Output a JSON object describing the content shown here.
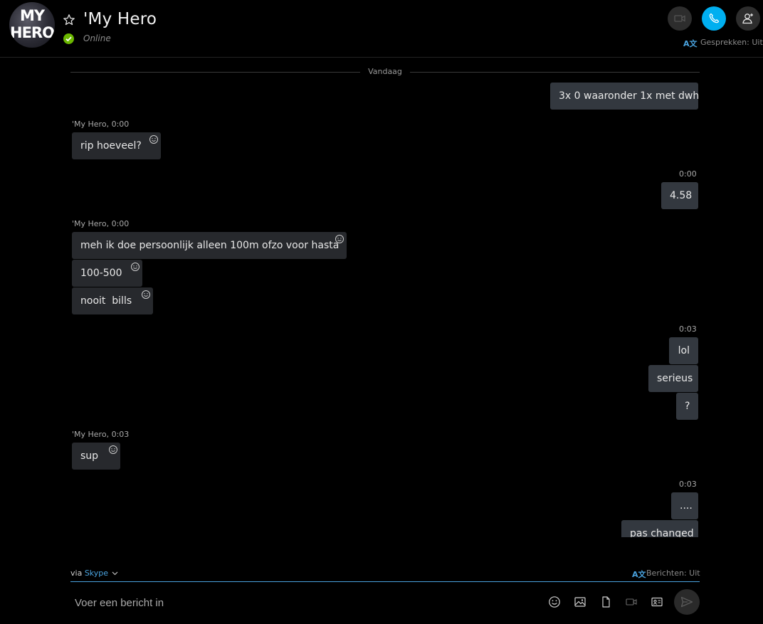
{
  "header": {
    "avatar_text_line1": "MY",
    "avatar_text_line2": "HERO",
    "contact_name": "'My Hero",
    "status": "Online",
    "translator_icon": "A文",
    "translator_label": "Gesprekken: Uit"
  },
  "messages": {
    "date_divider": "Vandaag",
    "items": [
      {
        "type": "out",
        "text": "3x 0 waaronder 1x met dwh"
      },
      {
        "type": "meta_in",
        "text": "'My Hero, 0:00"
      },
      {
        "type": "in",
        "text": "rip hoeveel?"
      },
      {
        "type": "meta_out",
        "text": "0:00"
      },
      {
        "type": "out",
        "text": "4.58"
      },
      {
        "type": "meta_in",
        "text": "'My Hero, 0:00"
      },
      {
        "type": "in",
        "text": "meh ik doe persoonlijk alleen 100m ofzo voor hasta"
      },
      {
        "type": "in",
        "text": "100-500"
      },
      {
        "type": "in",
        "text": "nooit  bills"
      },
      {
        "type": "meta_out",
        "text": "0:03"
      },
      {
        "type": "out",
        "text": "lol"
      },
      {
        "type": "out",
        "text": "serieus"
      },
      {
        "type": "out",
        "text": "?"
      },
      {
        "type": "meta_in",
        "text": "'My Hero, 0:03"
      },
      {
        "type": "in",
        "text": "sup"
      },
      {
        "type": "meta_out",
        "text": "0:03"
      },
      {
        "type": "out",
        "text": "...."
      },
      {
        "type": "out",
        "text": "pas changed"
      }
    ]
  },
  "composer": {
    "via_label": "via",
    "via_service": "Skype",
    "translator_icon": "A文",
    "translator_label": "Berichten: Uit",
    "placeholder": "Voer een bericht in"
  },
  "colors": {
    "accent": "#00aff0",
    "link": "#4aa3df",
    "online": "#6bb700",
    "bubble_in": "#27292d",
    "bubble_out": "#33383f"
  },
  "icons": [
    "star-icon",
    "video-call-icon",
    "audio-call-icon",
    "add-people-icon",
    "emoji-icon",
    "image-icon",
    "file-icon",
    "video-message-icon",
    "contact-card-icon",
    "send-icon"
  ]
}
